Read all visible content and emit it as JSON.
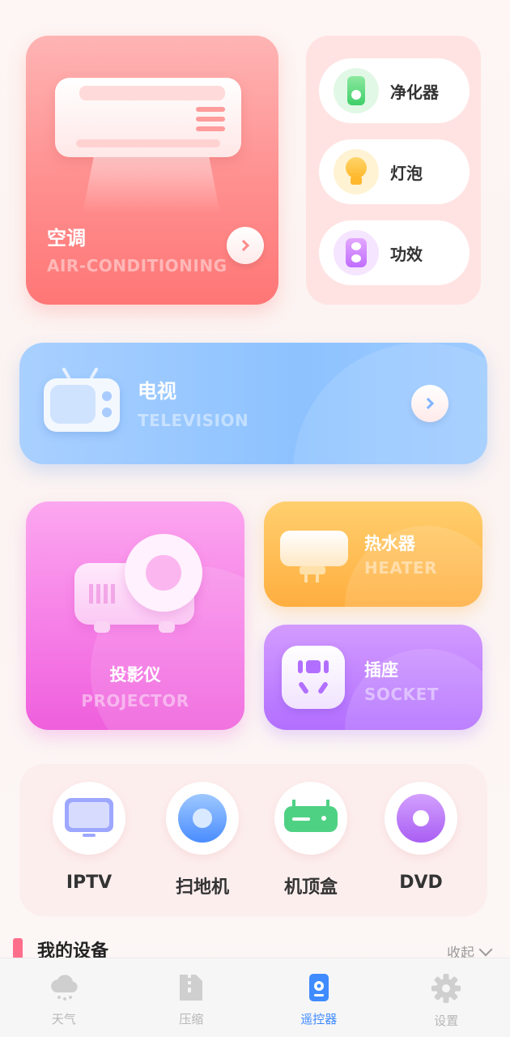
{
  "ac": {
    "title": "空调",
    "subtitle": "AIR-CONDITIONING"
  },
  "mini": [
    {
      "label": "净化器",
      "icon": "air-purifier-icon"
    },
    {
      "label": "灯泡",
      "icon": "light-bulb-icon"
    },
    {
      "label": "功效",
      "icon": "amplifier-icon"
    }
  ],
  "tv": {
    "title": "电视",
    "subtitle": "TELEVISION"
  },
  "projector": {
    "title": "投影仪",
    "subtitle": "PROJECTOR"
  },
  "heater": {
    "title": "热水器",
    "subtitle": "HEATER"
  },
  "socket": {
    "title": "插座",
    "subtitle": "SOCKET"
  },
  "quick": [
    {
      "label": "IPTV",
      "icon": "iptv-icon"
    },
    {
      "label": "扫地机",
      "icon": "robot-vacuum-icon"
    },
    {
      "label": "机顶盒",
      "icon": "set-top-box-icon"
    },
    {
      "label": "DVD",
      "icon": "dvd-icon"
    }
  ],
  "devices": {
    "title": "我的设备",
    "collapse_label": "收起"
  },
  "tabs": [
    {
      "label": "天气",
      "icon": "weather-cloud-icon"
    },
    {
      "label": "压缩",
      "icon": "zip-file-icon"
    },
    {
      "label": "遥控器",
      "icon": "remote-control-icon"
    },
    {
      "label": "设置",
      "icon": "gear-icon"
    }
  ],
  "colors": {
    "accent": "#3f8bff",
    "ac": "#ff8f8f",
    "tv": "#8dc2ff",
    "projector": "#f57be6",
    "heater": "#ffae3f",
    "socket": "#b26fff"
  }
}
